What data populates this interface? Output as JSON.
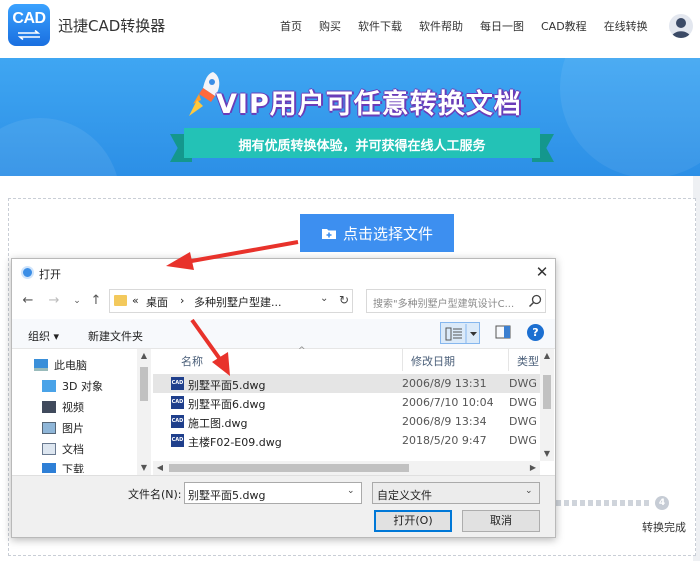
{
  "header": {
    "logo_text": "CAD",
    "brand": "迅捷CAD转换器",
    "nav": [
      "首页",
      "购买",
      "软件下载",
      "软件帮助",
      "每日一图",
      "CAD教程",
      "在线转换"
    ]
  },
  "banner": {
    "title": "VIP用户可任意转换文档",
    "subtitle": "拥有优质转换体验，并可获得在线人工服务"
  },
  "upload": {
    "choose_file": "点击选择文件",
    "step_number": "4",
    "step_label": "转换完成"
  },
  "dialog": {
    "title": "打开",
    "address": {
      "prefix": "«",
      "segment1": "桌面",
      "separator": "›",
      "segment2": "多种别墅户型建..."
    },
    "search_placeholder": "搜索\"多种别墅户型建筑设计C...",
    "organize": "组织 ▾",
    "new_folder": "新建文件夹",
    "help": "?",
    "nav_tree": [
      {
        "label": "此电脑"
      },
      {
        "label": "3D 对象"
      },
      {
        "label": "视频"
      },
      {
        "label": "图片"
      },
      {
        "label": "文档"
      },
      {
        "label": "下载"
      }
    ],
    "columns": {
      "name": "名称",
      "date": "修改日期",
      "type": "类型"
    },
    "file_icon_text": "CAD",
    "files": [
      {
        "name": "别墅平面5.dwg",
        "date": "2006/8/9 13:31",
        "type": "DWG"
      },
      {
        "name": "别墅平面6.dwg",
        "date": "2006/7/10 10:04",
        "type": "DWG"
      },
      {
        "name": "施工图.dwg",
        "date": "2006/8/9 13:34",
        "type": "DWG"
      },
      {
        "name": "主楼F02-E09.dwg",
        "date": "2018/5/20 9:47",
        "type": "DWG"
      }
    ],
    "filename_label": "文件名(N):",
    "filename_value": "别墅平面5.dwg",
    "filetype_value": "自定义文件",
    "open_button": "打开(O)",
    "cancel_button": "取消"
  },
  "colors": {
    "banner_blue": "#2c8fe6",
    "button_blue": "#3d8ff0",
    "ribbon_teal": "#23c2b6",
    "arrow_red": "#e8322b"
  }
}
